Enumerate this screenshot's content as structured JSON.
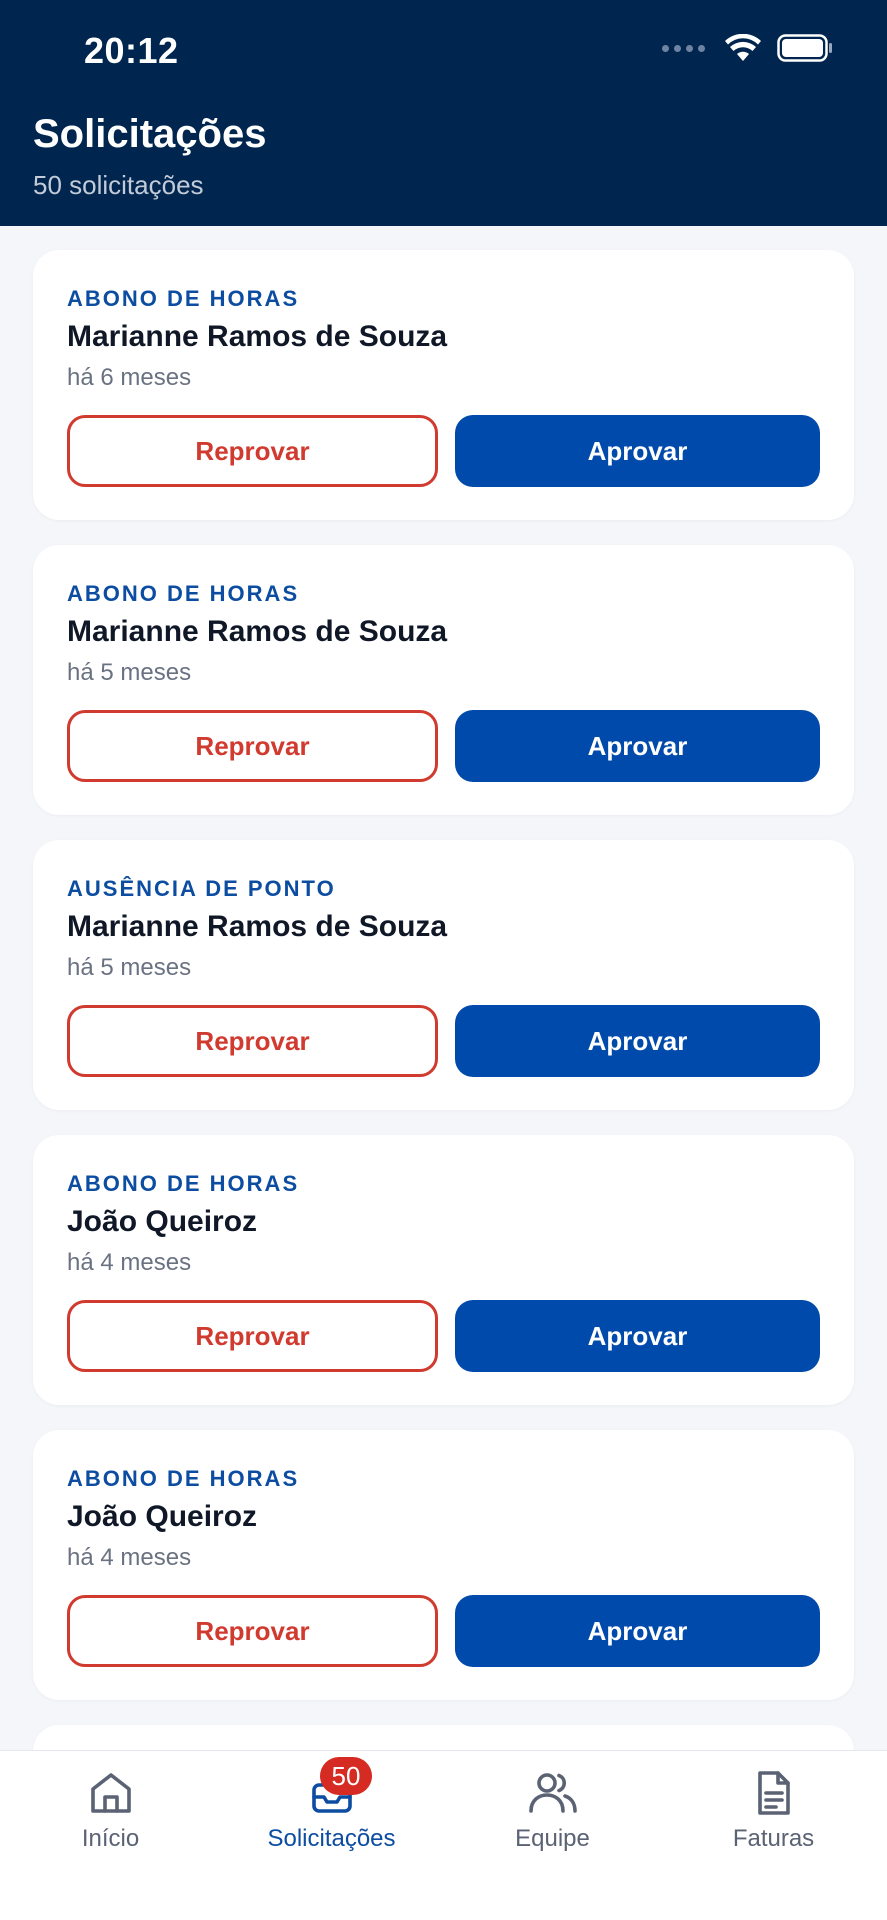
{
  "status_bar": {
    "time": "20:12"
  },
  "header": {
    "title": "Solicitações",
    "subtitle": "50 solicitações"
  },
  "requests": [
    {
      "type": "ABONO DE HORAS",
      "name": "Marianne Ramos de Souza",
      "date": "há 6 meses",
      "reject_label": "Reprovar",
      "approve_label": "Aprovar"
    },
    {
      "type": "ABONO DE HORAS",
      "name": "Marianne Ramos de Souza",
      "date": "há 5 meses",
      "reject_label": "Reprovar",
      "approve_label": "Aprovar"
    },
    {
      "type": "AUSÊNCIA DE PONTO",
      "name": "Marianne Ramos de Souza",
      "date": "há 5 meses",
      "reject_label": "Reprovar",
      "approve_label": "Aprovar"
    },
    {
      "type": "ABONO DE HORAS",
      "name": "João Queiroz",
      "date": "há 4 meses",
      "reject_label": "Reprovar",
      "approve_label": "Aprovar"
    },
    {
      "type": "ABONO DE HORAS",
      "name": "João Queiroz",
      "date": "há 4 meses",
      "reject_label": "Reprovar",
      "approve_label": "Aprovar"
    }
  ],
  "tabbar": {
    "items": [
      {
        "label": "Início",
        "icon": "home-icon",
        "active": false
      },
      {
        "label": "Solicitações",
        "icon": "inbox-icon",
        "active": true,
        "badge": "50"
      },
      {
        "label": "Equipe",
        "icon": "users-icon",
        "active": false
      },
      {
        "label": "Faturas",
        "icon": "document-icon",
        "active": false
      }
    ]
  },
  "colors": {
    "header_bg": "#00264f",
    "accent": "#004aab",
    "reject": "#d13a2f",
    "badge": "#d52b22"
  }
}
